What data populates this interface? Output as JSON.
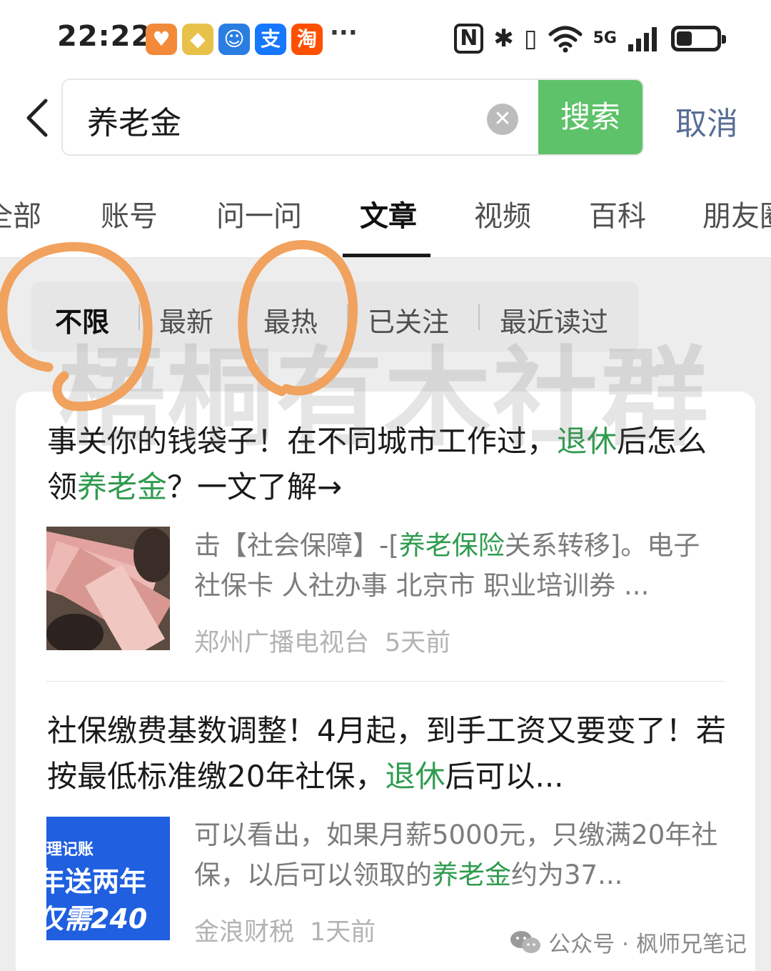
{
  "status_bar": {
    "time": "22:22",
    "apps": [
      {
        "name": "app-icon-orange-heart",
        "glyph": "♥",
        "color": "#f28a3a"
      },
      {
        "name": "app-icon-honor-diamond",
        "glyph": "◆",
        "color": "#e8c14a"
      },
      {
        "name": "app-icon-blue-robot",
        "glyph": "☺",
        "color": "#2a7de1"
      },
      {
        "name": "app-icon-alipay",
        "glyph": "支",
        "color": "#1677ff"
      },
      {
        "name": "app-icon-taobao",
        "glyph": "淘",
        "color": "#ff5000"
      }
    ],
    "more": "···",
    "network_label": "5G",
    "battery_level": 0.35
  },
  "search": {
    "query": "养老金",
    "search_label": "搜索",
    "cancel_label": "取消"
  },
  "tabs": [
    {
      "label": "全部",
      "active": false
    },
    {
      "label": "账号",
      "active": false
    },
    {
      "label": "问一问",
      "active": false
    },
    {
      "label": "文章",
      "active": true
    },
    {
      "label": "视频",
      "active": false
    },
    {
      "label": "百科",
      "active": false
    },
    {
      "label": "朋友圈",
      "active": false
    }
  ],
  "filters": [
    {
      "label": "不限",
      "active": true
    },
    {
      "label": "最新",
      "active": false
    },
    {
      "label": "最热",
      "active": false
    },
    {
      "label": "已关注",
      "active": false
    },
    {
      "label": "最近读过",
      "active": false
    }
  ],
  "results": [
    {
      "title_parts": [
        {
          "text": "事关你的钱袋子！在不同城市工作过，",
          "hl": false
        },
        {
          "text": "退休",
          "hl": true
        },
        {
          "text": "后怎么领",
          "hl": false
        },
        {
          "text": "养老金",
          "hl": true
        },
        {
          "text": "？一文了解→",
          "hl": false
        }
      ],
      "snippet_parts": [
        {
          "text": "击【社会保障】-[",
          "hl": false
        },
        {
          "text": "养老保险",
          "hl": true
        },
        {
          "text": "关系转移]。电子社保卡 人社办事 北京市 职业培训券 ...",
          "hl": false
        }
      ],
      "source": "郑州广播电视台",
      "time": "5天前",
      "thumb_text": []
    },
    {
      "title_parts": [
        {
          "text": "社保缴费基数调整！4月起，到手工资又要变了！若按最低标准缴20年社保，",
          "hl": false
        },
        {
          "text": "退休",
          "hl": true
        },
        {
          "text": "后可以...",
          "hl": false
        }
      ],
      "snippet_parts": [
        {
          "text": "可以看出，如果月薪5000元，只缴满20年社保，以后可以领取的",
          "hl": false
        },
        {
          "text": "养老金",
          "hl": true
        },
        {
          "text": "约为37...",
          "hl": false
        }
      ],
      "source": "金浪财税",
      "time": "1天前",
      "thumb_text": [
        "理记账",
        "年送两年",
        "仅需240"
      ]
    }
  ],
  "watermark": "梧桐有木社群",
  "footer": {
    "account_prefix": "公众号 · ",
    "account_name": "枫师兄笔记"
  }
}
